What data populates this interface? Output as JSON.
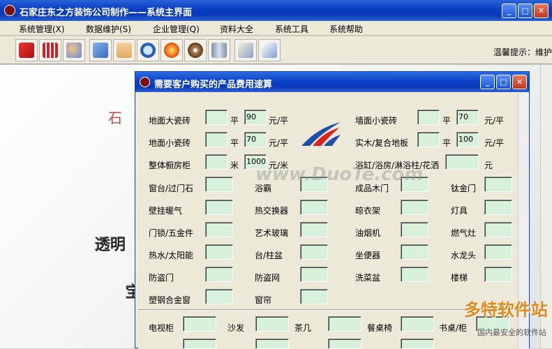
{
  "app": {
    "title": "石家庄东之方装饰公司制作——系统主界面",
    "window_buttons": {
      "minimize": "_",
      "maximize": "□",
      "close": "✕"
    }
  },
  "menu": [
    "系统管理(X)",
    "数据维护(S)",
    "企业管理(Q)",
    "资料大全",
    "系统工具",
    "系统帮助"
  ],
  "toolbar": {
    "icons": [
      "edit-icon",
      "calculator-icon",
      "users-icon",
      "settings-icon",
      "person-icon",
      "search-icon",
      "flame-icon",
      "disc-icon",
      "building-icon",
      "checklist-icon",
      "export-icon"
    ],
    "hint": "温馨提示：维护"
  },
  "background": {
    "text1": "石",
    "text2": "透明",
    "text3": "宝"
  },
  "dialog": {
    "title": "需要客户购买的产品费用速算",
    "pricing_rows": [
      {
        "label": "地面大瓷砖",
        "unit1": "平",
        "price": "90",
        "unit2": "元/平"
      },
      {
        "label": "地面小瓷砖",
        "unit1": "平",
        "price": "70",
        "unit2": "元/平"
      },
      {
        "label": "整体橱房柜",
        "unit1": "米",
        "price": "1000",
        "unit2": "元/米"
      },
      {
        "label": "墙面小瓷砖",
        "unit1": "平",
        "price": "70",
        "unit2": "元/平"
      },
      {
        "label": "实木/复合地板",
        "unit1": "平",
        "price": "100",
        "unit2": "元/平"
      },
      {
        "label": "浴缸/浴房/淋浴柱/花洒",
        "unit2": "元"
      }
    ],
    "items_col1": [
      "窗台/过门石",
      "壁挂暖气",
      "门锁/五金件",
      "热水/太阳能",
      "防盗门",
      "塑钢合金窗"
    ],
    "items_col2": [
      "浴霸",
      "热交换器",
      "艺术玻璃",
      "台/柱盆",
      "防盗网",
      "窗帘"
    ],
    "items_col3": [
      "成品木门",
      "晾衣架",
      "油烟机",
      "坐便器",
      "洗菜盆"
    ],
    "items_col4": [
      "钛金门",
      "灯具",
      "燃气灶",
      "水龙头",
      "楼梯"
    ],
    "furniture": [
      "电视柜",
      "沙发",
      "茶几",
      "餐桌椅",
      "书桌/柜"
    ]
  },
  "watermark": {
    "center": "www.DuoTe.com",
    "brand": "多特软件站",
    "brand_sub": "国内最安全的软件站"
  },
  "colors": {
    "titlebar": "#0b3ab8",
    "field": "#d7f0d9",
    "window": "#ece9d8"
  }
}
